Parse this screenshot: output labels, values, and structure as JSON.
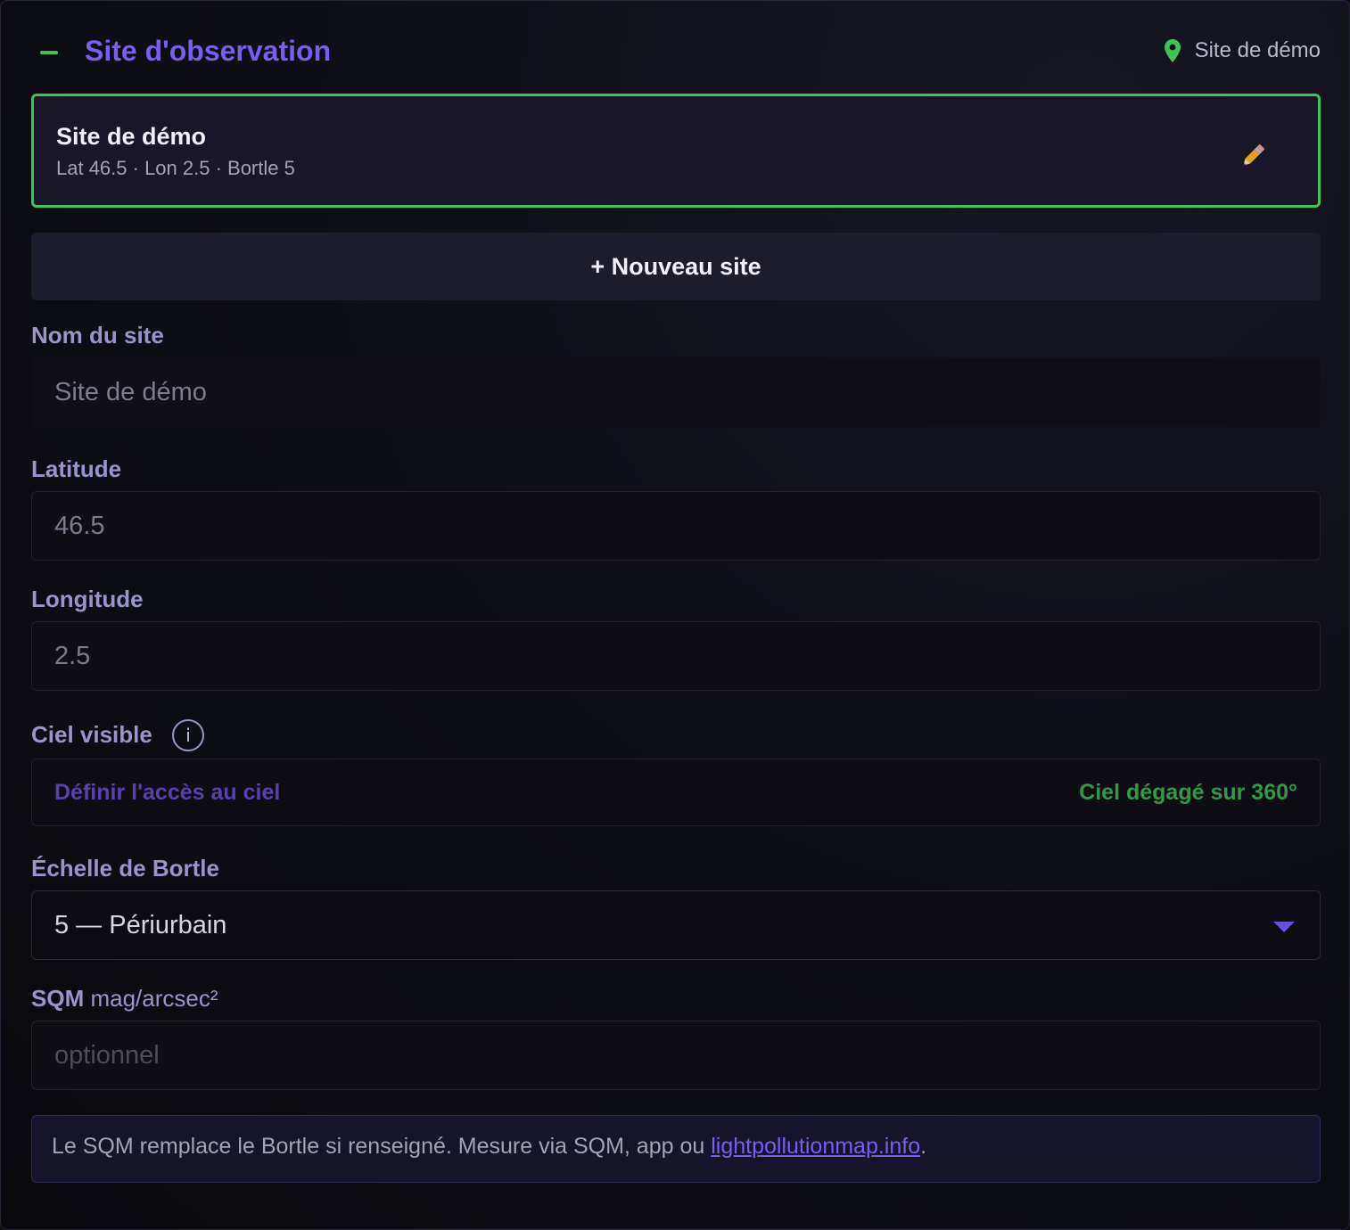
{
  "header": {
    "title": "Site d'observation",
    "current_site": "Site de démo"
  },
  "selected_site": {
    "name": "Site de démo",
    "meta": "Lat 46.5 · Lon 2.5 · Bortle 5"
  },
  "new_site_label": "+ Nouveau site",
  "form": {
    "name": {
      "label": "Nom du site",
      "value": "Site de démo"
    },
    "latitude": {
      "label": "Latitude",
      "value": "46.5"
    },
    "longitude": {
      "label": "Longitude",
      "value": "2.5"
    },
    "sky": {
      "label": "Ciel visible",
      "info_glyph": "i",
      "link": "Définir l'accès au ciel",
      "status": "Ciel dégagé sur 360°"
    },
    "bortle": {
      "label": "Échelle de Bortle",
      "value": "5 — Périurbain"
    },
    "sqm": {
      "label": "SQM",
      "unit": "mag/arcsec²",
      "placeholder": "optionnel",
      "value": ""
    }
  },
  "note": {
    "text": "Le SQM remplace le Bortle si renseigné. Mesure via SQM, app ou ",
    "link": "lightpollutionmap.info",
    "suffix": "."
  },
  "icons": {
    "collapse": "minus-icon",
    "location": "map-pin-icon",
    "edit": "pencil-icon",
    "info": "info-icon",
    "dropdown": "caret-down-icon"
  },
  "colors": {
    "accent": "#7b5cf0",
    "success": "#3ec35a",
    "background": "#0b0b10"
  }
}
